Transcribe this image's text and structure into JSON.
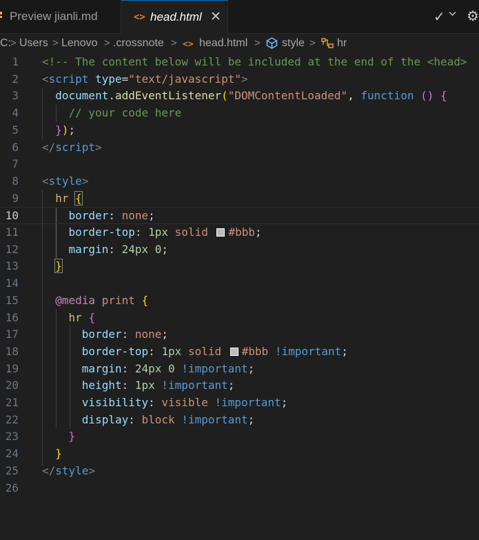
{
  "tabs": [
    {
      "label": "Preview jianli.md",
      "active": false,
      "icon": "markdown-preview-icon"
    },
    {
      "label": "head.html",
      "active": true,
      "icon": "html-file-icon",
      "close": "✕"
    }
  ],
  "tab_actions": {
    "check": "✓",
    "chevron": "⌄",
    "gear": "⚙"
  },
  "breadcrumb": {
    "items": [
      "C:",
      "Users",
      "Lenovo",
      ".crossnote",
      "head.html",
      "style",
      "hr"
    ],
    "icons": {
      "file": "<>",
      "style": "style-symbol-icon",
      "hr": "hr-symbol-icon"
    }
  },
  "editor": {
    "active_line": 10,
    "line_numbers": [
      "1",
      "2",
      "3",
      "4",
      "5",
      "6",
      "7",
      "8",
      "9",
      "10",
      "11",
      "12",
      "13",
      "14",
      "15",
      "16",
      "17",
      "18",
      "19",
      "20",
      "21",
      "22",
      "23",
      "24",
      "25",
      "26"
    ],
    "lines": [
      {
        "tokens": [
          {
            "t": "<!-- The content below will be included at the end of the <head>",
            "k": "comment"
          }
        ]
      },
      {
        "tokens": [
          {
            "t": "<",
            "k": "punct"
          },
          {
            "t": "script",
            "k": "tag"
          },
          {
            "t": " ",
            "k": "plain"
          },
          {
            "t": "type",
            "k": "attr"
          },
          {
            "t": "=",
            "k": "plain"
          },
          {
            "t": "\"text/javascript\"",
            "k": "str"
          },
          {
            "t": ">",
            "k": "punct"
          }
        ]
      },
      {
        "tokens": [
          {
            "t": "  ",
            "k": "plain"
          },
          {
            "t": "document",
            "k": "id"
          },
          {
            "t": ".",
            "k": "plain"
          },
          {
            "t": "addEventListener",
            "k": "fn"
          },
          {
            "t": "(",
            "k": "br1"
          },
          {
            "t": "\"DOMContentLoaded\"",
            "k": "str"
          },
          {
            "t": ", ",
            "k": "plain"
          },
          {
            "t": "function",
            "k": "kw"
          },
          {
            "t": " ",
            "k": "plain"
          },
          {
            "t": "()",
            "k": "br2"
          },
          {
            "t": " ",
            "k": "plain"
          },
          {
            "t": "{",
            "k": "br2"
          }
        ]
      },
      {
        "tokens": [
          {
            "t": "    ",
            "k": "plain"
          },
          {
            "t": "// your code here",
            "k": "comment"
          }
        ]
      },
      {
        "tokens": [
          {
            "t": "  ",
            "k": "plain"
          },
          {
            "t": "}",
            "k": "br2"
          },
          {
            "t": ")",
            "k": "br1"
          },
          {
            "t": ";",
            "k": "plain"
          }
        ]
      },
      {
        "tokens": [
          {
            "t": "</",
            "k": "punct"
          },
          {
            "t": "script",
            "k": "tag"
          },
          {
            "t": ">",
            "k": "punct"
          }
        ]
      },
      {
        "tokens": []
      },
      {
        "tokens": [
          {
            "t": "<",
            "k": "punct"
          },
          {
            "t": "style",
            "k": "tag"
          },
          {
            "t": ">",
            "k": "punct"
          }
        ]
      },
      {
        "tokens": [
          {
            "t": "  ",
            "k": "plain"
          },
          {
            "t": "hr",
            "k": "sel"
          },
          {
            "t": " ",
            "k": "plain"
          },
          {
            "t": "{",
            "k": "br1box"
          }
        ]
      },
      {
        "tokens": [
          {
            "t": "    ",
            "k": "plain"
          },
          {
            "t": "border",
            "k": "prop"
          },
          {
            "t": ": ",
            "k": "plain"
          },
          {
            "t": "none",
            "k": "val"
          },
          {
            "t": ";",
            "k": "plain"
          }
        ]
      },
      {
        "tokens": [
          {
            "t": "    ",
            "k": "plain"
          },
          {
            "t": "border-top",
            "k": "prop"
          },
          {
            "t": ": ",
            "k": "plain"
          },
          {
            "t": "1px",
            "k": "num"
          },
          {
            "t": " ",
            "k": "plain"
          },
          {
            "t": "solid",
            "k": "val"
          },
          {
            "t": " ",
            "k": "plain"
          },
          {
            "t": "",
            "k": "swatch"
          },
          {
            "t": "#bbb",
            "k": "val"
          },
          {
            "t": ";",
            "k": "plain"
          }
        ]
      },
      {
        "tokens": [
          {
            "t": "    ",
            "k": "plain"
          },
          {
            "t": "margin",
            "k": "prop"
          },
          {
            "t": ": ",
            "k": "plain"
          },
          {
            "t": "24px",
            "k": "num"
          },
          {
            "t": " ",
            "k": "plain"
          },
          {
            "t": "0",
            "k": "num"
          },
          {
            "t": ";",
            "k": "plain"
          }
        ]
      },
      {
        "tokens": [
          {
            "t": "  ",
            "k": "plain"
          },
          {
            "t": "}",
            "k": "br1box"
          }
        ]
      },
      {
        "tokens": []
      },
      {
        "tokens": [
          {
            "t": "  ",
            "k": "plain"
          },
          {
            "t": "@media",
            "k": "at"
          },
          {
            "t": " ",
            "k": "plain"
          },
          {
            "t": "print",
            "k": "val"
          },
          {
            "t": " ",
            "k": "plain"
          },
          {
            "t": "{",
            "k": "br1"
          }
        ]
      },
      {
        "tokens": [
          {
            "t": "    ",
            "k": "plain"
          },
          {
            "t": "hr",
            "k": "sel"
          },
          {
            "t": " ",
            "k": "plain"
          },
          {
            "t": "{",
            "k": "br2"
          }
        ]
      },
      {
        "tokens": [
          {
            "t": "      ",
            "k": "plain"
          },
          {
            "t": "border",
            "k": "prop"
          },
          {
            "t": ": ",
            "k": "plain"
          },
          {
            "t": "none",
            "k": "val"
          },
          {
            "t": ";",
            "k": "plain"
          }
        ]
      },
      {
        "tokens": [
          {
            "t": "      ",
            "k": "plain"
          },
          {
            "t": "border-top",
            "k": "prop"
          },
          {
            "t": ": ",
            "k": "plain"
          },
          {
            "t": "1px",
            "k": "num"
          },
          {
            "t": " ",
            "k": "plain"
          },
          {
            "t": "solid",
            "k": "val"
          },
          {
            "t": " ",
            "k": "plain"
          },
          {
            "t": "",
            "k": "swatch"
          },
          {
            "t": "#bbb",
            "k": "val"
          },
          {
            "t": " ",
            "k": "plain"
          },
          {
            "t": "!important",
            "k": "imp"
          },
          {
            "t": ";",
            "k": "plain"
          }
        ]
      },
      {
        "tokens": [
          {
            "t": "      ",
            "k": "plain"
          },
          {
            "t": "margin",
            "k": "prop"
          },
          {
            "t": ": ",
            "k": "plain"
          },
          {
            "t": "24px",
            "k": "num"
          },
          {
            "t": " ",
            "k": "plain"
          },
          {
            "t": "0",
            "k": "num"
          },
          {
            "t": " ",
            "k": "plain"
          },
          {
            "t": "!important",
            "k": "imp"
          },
          {
            "t": ";",
            "k": "plain"
          }
        ]
      },
      {
        "tokens": [
          {
            "t": "      ",
            "k": "plain"
          },
          {
            "t": "height",
            "k": "prop"
          },
          {
            "t": ": ",
            "k": "plain"
          },
          {
            "t": "1px",
            "k": "num"
          },
          {
            "t": " ",
            "k": "plain"
          },
          {
            "t": "!important",
            "k": "imp"
          },
          {
            "t": ";",
            "k": "plain"
          }
        ]
      },
      {
        "tokens": [
          {
            "t": "      ",
            "k": "plain"
          },
          {
            "t": "visibility",
            "k": "prop"
          },
          {
            "t": ": ",
            "k": "plain"
          },
          {
            "t": "visible",
            "k": "val"
          },
          {
            "t": " ",
            "k": "plain"
          },
          {
            "t": "!important",
            "k": "imp"
          },
          {
            "t": ";",
            "k": "plain"
          }
        ]
      },
      {
        "tokens": [
          {
            "t": "      ",
            "k": "plain"
          },
          {
            "t": "display",
            "k": "prop"
          },
          {
            "t": ": ",
            "k": "plain"
          },
          {
            "t": "block",
            "k": "val"
          },
          {
            "t": " ",
            "k": "plain"
          },
          {
            "t": "!important",
            "k": "imp"
          },
          {
            "t": ";",
            "k": "plain"
          }
        ]
      },
      {
        "tokens": [
          {
            "t": "    ",
            "k": "plain"
          },
          {
            "t": "}",
            "k": "br2"
          }
        ]
      },
      {
        "tokens": [
          {
            "t": "  ",
            "k": "plain"
          },
          {
            "t": "}",
            "k": "br1"
          }
        ]
      },
      {
        "tokens": [
          {
            "t": "</",
            "k": "punct"
          },
          {
            "t": "style",
            "k": "tag"
          },
          {
            "t": ">",
            "k": "punct"
          }
        ]
      },
      {
        "tokens": []
      }
    ]
  },
  "colors": {
    "background": "#1f1f1f",
    "tabbar": "#181818",
    "accent": "#0078d4",
    "html_icon": "#e37933"
  }
}
